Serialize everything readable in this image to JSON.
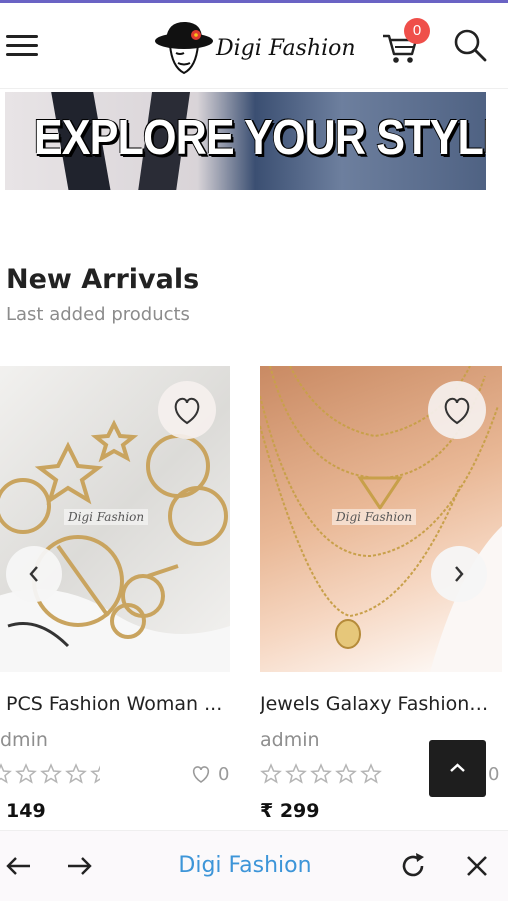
{
  "header": {
    "brand": "Digi Fashion",
    "cart_count": "0"
  },
  "banner": {
    "text": "EXPLORE YOUR STYLE"
  },
  "section": {
    "title": "New Arrivals",
    "subtitle": "Last added products"
  },
  "products": [
    {
      "title": "PCS Fashion Woman ...",
      "author": "dmin",
      "rating_stars": 0,
      "likes": "0",
      "price": "149",
      "watermark": "Digi Fashion"
    },
    {
      "title": "Jewels Galaxy Fashiona...",
      "author": "admin",
      "rating_stars": 0,
      "likes": "0",
      "price": "₹ 299",
      "watermark": "Digi Fashion"
    }
  ],
  "bottom_bar": {
    "title": "Digi Fashion"
  },
  "colors": {
    "accent_bar": "#6a63c4",
    "badge": "#ef4f4a",
    "link_blue": "#3d95d8",
    "scroll_btn": "#1e1e1e"
  },
  "icons": {
    "menu": "menu-icon",
    "cart": "cart-icon",
    "search": "search-icon",
    "wishlist": "heart-icon",
    "prev": "chevron-left-icon",
    "next": "chevron-right-icon",
    "scroll_top": "chevron-up-icon",
    "back": "arrow-left-icon",
    "forward": "arrow-right-icon",
    "refresh": "refresh-icon",
    "close": "close-icon"
  }
}
